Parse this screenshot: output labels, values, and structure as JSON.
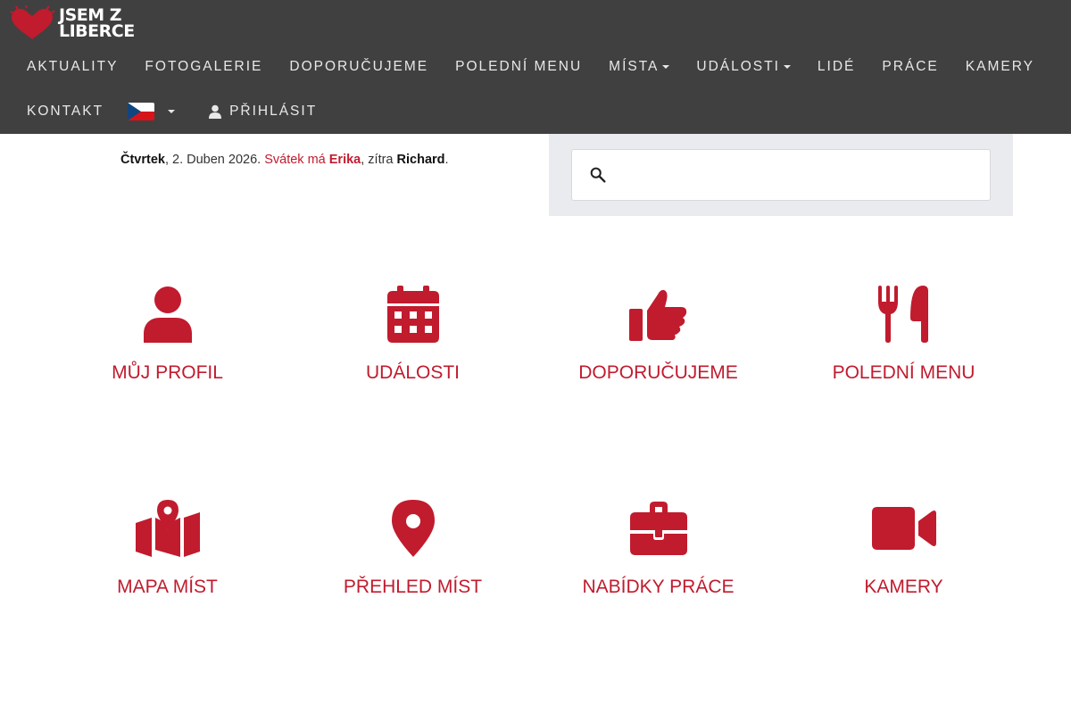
{
  "brand": {
    "line1": "JSEM Z",
    "line2": "LIBERCE"
  },
  "nav": {
    "aktuality": "AKTUALITY",
    "fotogalerie": "FOTOGALERIE",
    "doporucujeme": "DOPORUČUJEME",
    "poledni_menu": "POLEDNÍ MENU",
    "mista": "MÍSTA",
    "udalosti": "UDÁLOSTI",
    "lide": "LIDÉ",
    "prace": "PRÁCE",
    "kamery": "KAMERY",
    "kontakt": "KONTAKT",
    "prihlasit": "PŘIHLÁSIT"
  },
  "date": {
    "day": "Čtvrtek",
    "date_text": ", 2. Duben 2026. ",
    "svatek_label": "Svátek má ",
    "svatek_name": "Erika",
    "tomorrow_label": ", zítra ",
    "tomorrow_name": "Richard",
    "end": "."
  },
  "search": {
    "placeholder": ""
  },
  "tiles": {
    "profil": "MŮJ PROFIL",
    "udalosti": "UDÁLOSTI",
    "doporucujeme": "DOPORUČUJEME",
    "poledni_menu": "POLEDNÍ MENU",
    "mapa_mist": "MAPA MÍST",
    "prehled_mist": "PŘEHLED MÍST",
    "nabidky_prace": "NABÍDKY PRÁCE",
    "kamery": "KAMERY"
  },
  "colors": {
    "accent": "#c11b2e",
    "navbar": "#404040",
    "search_panel": "#e9ebee"
  }
}
